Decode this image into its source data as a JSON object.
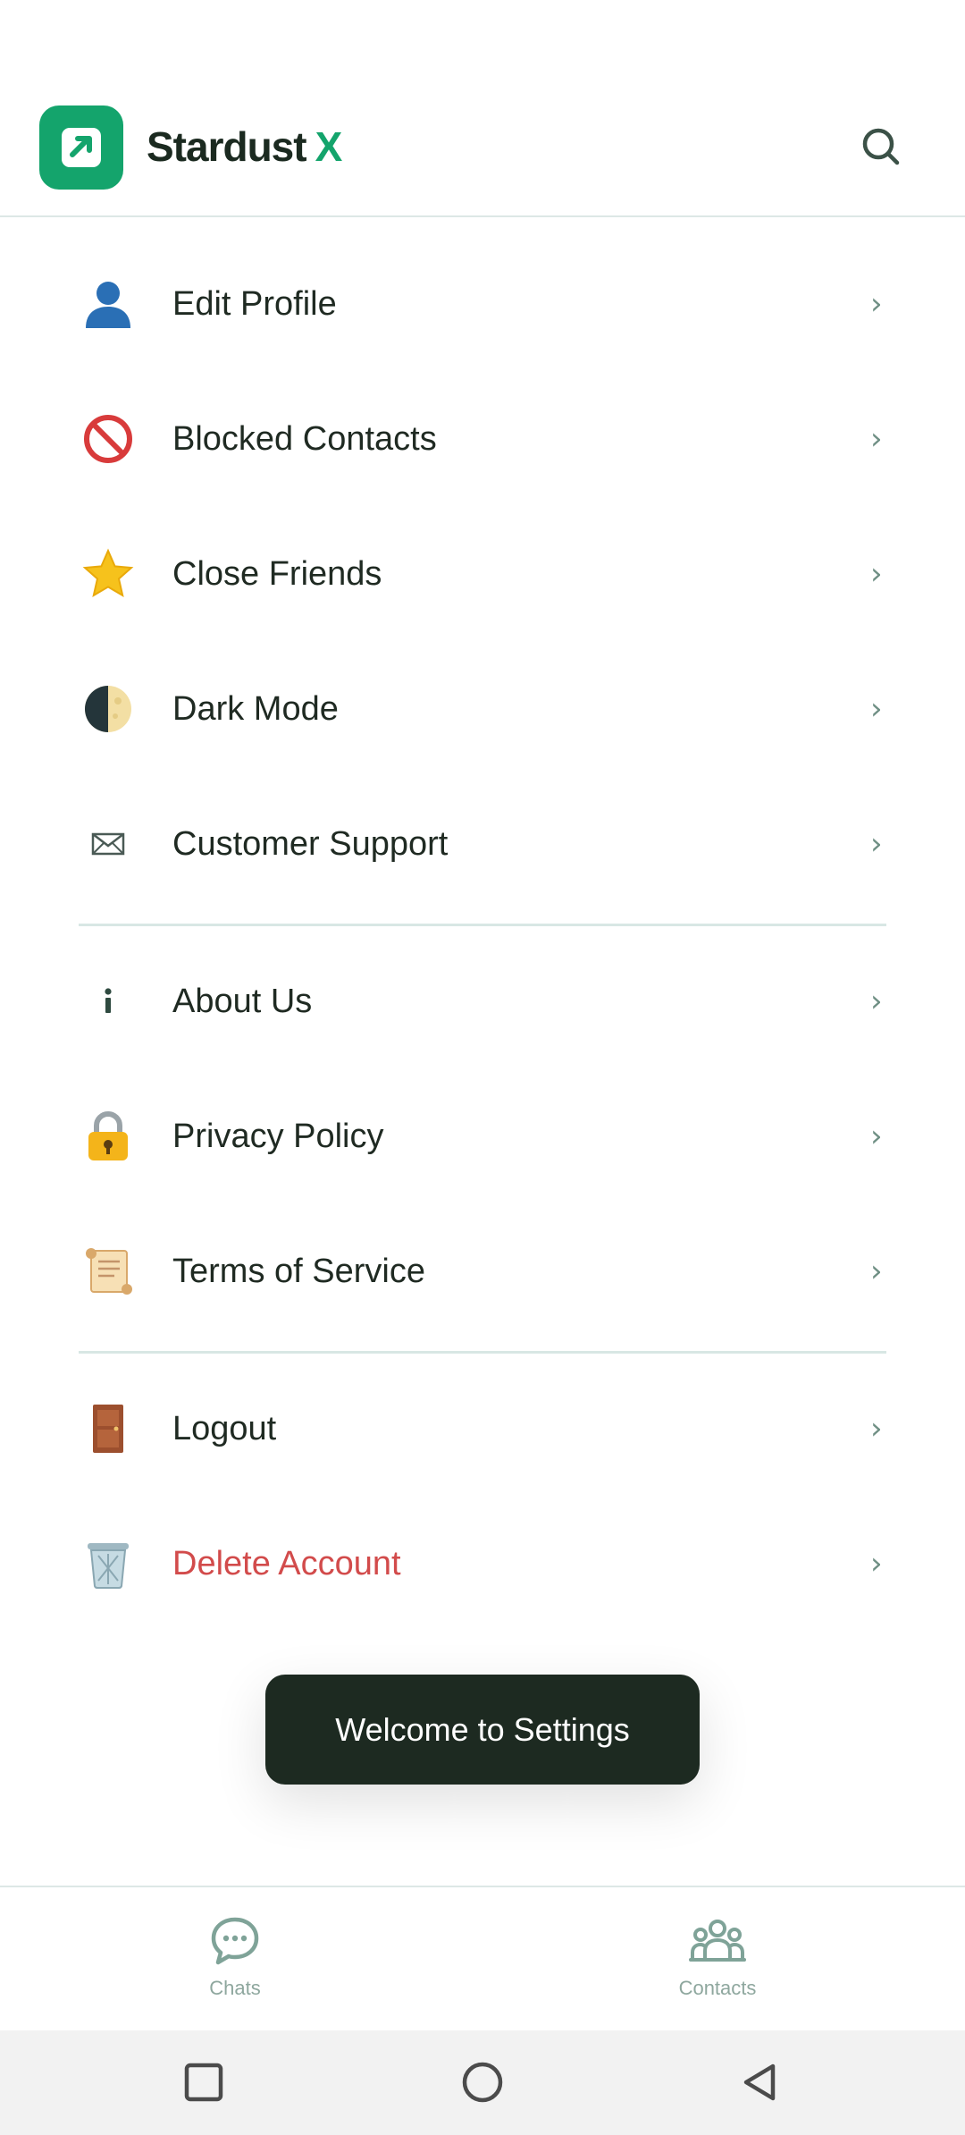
{
  "header": {
    "brand_name": "Stardust",
    "brand_accent": "X",
    "accent_color": "#14a46c"
  },
  "menu": {
    "items": [
      {
        "label": "Edit Profile",
        "icon": "person-icon"
      },
      {
        "label": "Blocked Contacts",
        "icon": "prohibited-icon"
      },
      {
        "label": "Close Friends",
        "icon": "star-icon"
      },
      {
        "label": "Dark Mode",
        "icon": "half-moon-icon"
      },
      {
        "label": "Customer Support",
        "icon": "envelope-icon"
      },
      {
        "label": "About Us",
        "icon": "info-icon"
      },
      {
        "label": "Privacy Policy",
        "icon": "lock-icon"
      },
      {
        "label": "Terms of Service",
        "icon": "scroll-icon"
      },
      {
        "label": "Logout",
        "icon": "door-icon"
      },
      {
        "label": "Delete Account",
        "icon": "trash-icon",
        "color": "#d24b4b"
      }
    ],
    "chevron": "›"
  },
  "toast": {
    "text": "Welcome to Settings"
  },
  "bottom_nav": {
    "chats_label": "Chats",
    "contacts_label": "Contacts"
  }
}
